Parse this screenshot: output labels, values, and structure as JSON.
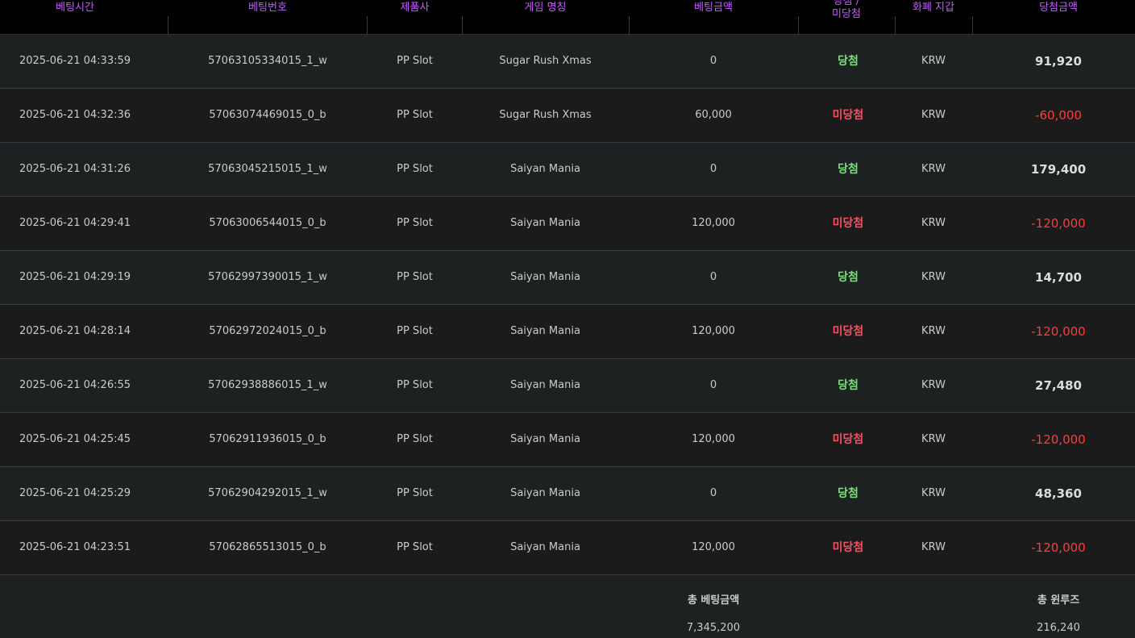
{
  "header": {
    "columns": [
      "베팅시간",
      "베팅번호",
      "제품사",
      "게임 명칭",
      "베팅금액",
      "당첨 / 미당첨",
      "화폐 지갑",
      "당첨금액"
    ],
    "result_top": "당첨 /",
    "result_bottom": "미당첨"
  },
  "rows": [
    {
      "time": "2025-06-21 04:33:59",
      "id": "57063105334015_1_w",
      "provider": "PP Slot",
      "game": "Sugar Rush Xmas",
      "bet": "0",
      "result": "당첨",
      "currency": "KRW",
      "amount": "91,920"
    },
    {
      "time": "2025-06-21 04:32:36",
      "id": "57063074469015_0_b",
      "provider": "PP Slot",
      "game": "Sugar Rush Xmas",
      "bet": "60,000",
      "result": "미당첨",
      "currency": "KRW",
      "amount": "-60,000"
    },
    {
      "time": "2025-06-21 04:31:26",
      "id": "57063045215015_1_w",
      "provider": "PP Slot",
      "game": "Saiyan Mania",
      "bet": "0",
      "result": "당첨",
      "currency": "KRW",
      "amount": "179,400"
    },
    {
      "time": "2025-06-21 04:29:41",
      "id": "57063006544015_0_b",
      "provider": "PP Slot",
      "game": "Saiyan Mania",
      "bet": "120,000",
      "result": "미당첨",
      "currency": "KRW",
      "amount": "-120,000"
    },
    {
      "time": "2025-06-21 04:29:19",
      "id": "57062997390015_1_w",
      "provider": "PP Slot",
      "game": "Saiyan Mania",
      "bet": "0",
      "result": "당첨",
      "currency": "KRW",
      "amount": "14,700"
    },
    {
      "time": "2025-06-21 04:28:14",
      "id": "57062972024015_0_b",
      "provider": "PP Slot",
      "game": "Saiyan Mania",
      "bet": "120,000",
      "result": "미당첨",
      "currency": "KRW",
      "amount": "-120,000"
    },
    {
      "time": "2025-06-21 04:26:55",
      "id": "57062938886015_1_w",
      "provider": "PP Slot",
      "game": "Saiyan Mania",
      "bet": "0",
      "result": "당첨",
      "currency": "KRW",
      "amount": "27,480"
    },
    {
      "time": "2025-06-21 04:25:45",
      "id": "57062911936015_0_b",
      "provider": "PP Slot",
      "game": "Saiyan Mania",
      "bet": "120,000",
      "result": "미당첨",
      "currency": "KRW",
      "amount": "-120,000"
    },
    {
      "time": "2025-06-21 04:25:29",
      "id": "57062904292015_1_w",
      "provider": "PP Slot",
      "game": "Saiyan Mania",
      "bet": "0",
      "result": "당첨",
      "currency": "KRW",
      "amount": "48,360"
    },
    {
      "time": "2025-06-21 04:23:51",
      "id": "57062865513015_0_b",
      "provider": "PP Slot",
      "game": "Saiyan Mania",
      "bet": "120,000",
      "result": "미당첨",
      "currency": "KRW",
      "amount": "-120,000"
    }
  ],
  "footer": {
    "total_bet_label": "총 베팅금액",
    "total_bet_value": "7,345,200",
    "total_win_label": "총 윈루즈",
    "total_win_value": "216,240"
  },
  "colors": {
    "header_text": "#c45cff",
    "win": "#7be07b",
    "lose": "#ff4b5e",
    "negative_amount": "#ff3b3b"
  }
}
